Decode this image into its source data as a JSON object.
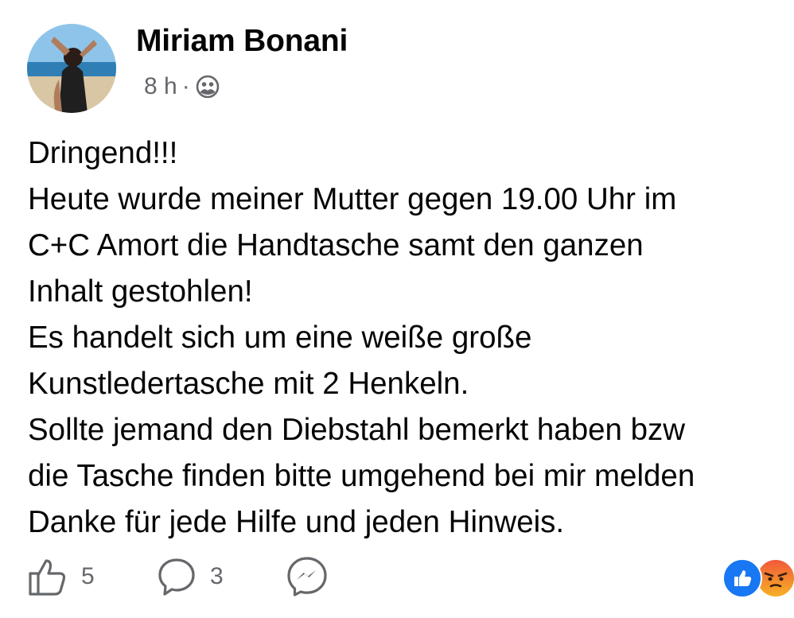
{
  "post": {
    "author": "Miriam Bonani",
    "time": "8 h",
    "separator": "·",
    "privacy_icon": "friends-icon",
    "text_lines": [
      "Dringend!!!",
      "Heute wurde meiner Mutter gegen 19.00 Uhr im",
      "C+C Amort die Handtasche samt den ganzen",
      "Inhalt gestohlen!",
      "Es handelt sich um eine weiße große",
      "Kunstledertasche mit 2 Henkeln.",
      "Sollte jemand den Diebstahl bemerkt haben bzw",
      "die Tasche finden bitte umgehend bei mir melden",
      "Danke für jede Hilfe und jeden Hinweis."
    ]
  },
  "actions": {
    "like_icon": "thumbs-up-icon",
    "like_count": "5",
    "comment_icon": "comment-icon",
    "comment_count": "3",
    "share_icon": "messenger-icon"
  },
  "reactions": [
    "like-reaction-icon",
    "angry-reaction-icon"
  ],
  "colors": {
    "text": "#050505",
    "secondary": "#65676b",
    "like_blue": "#1877f2",
    "angry_top": "#f0593a",
    "angry_bottom": "#f7b125"
  }
}
